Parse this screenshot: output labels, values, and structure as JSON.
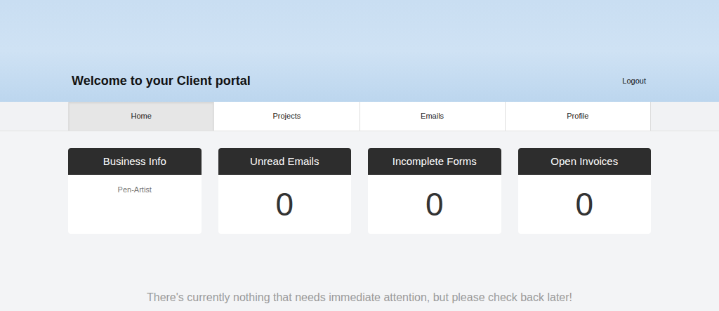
{
  "header": {
    "title": "Welcome to your Client portal",
    "logout": "Logout"
  },
  "tabs": [
    {
      "label": "Home",
      "selected": true
    },
    {
      "label": "Projects",
      "selected": false
    },
    {
      "label": "Emails",
      "selected": false
    },
    {
      "label": "Profile",
      "selected": false
    }
  ],
  "cards": [
    {
      "title": "Business Info",
      "kind": "info",
      "value": "Pen-Artist"
    },
    {
      "title": "Unread Emails",
      "kind": "count",
      "value": "0"
    },
    {
      "title": "Incomplete Forms",
      "kind": "count",
      "value": "0"
    },
    {
      "title": "Open Invoices",
      "kind": "count",
      "value": "0"
    }
  ],
  "message": "There's currently nothing that needs immediate attention, but please check back later!"
}
